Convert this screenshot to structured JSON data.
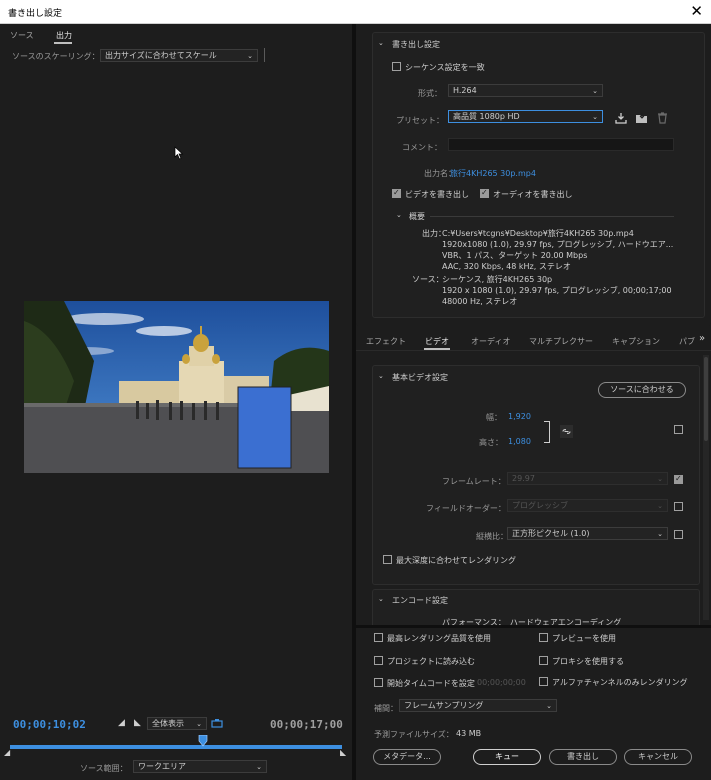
{
  "window": {
    "title": "書き出し設定",
    "close": "✕"
  },
  "left": {
    "tabs": [
      {
        "label": "ソース"
      },
      {
        "label": "出力"
      }
    ],
    "scaling_label": "ソースのスケーリング：",
    "scaling_value": "出力サイズに合わせてスケール",
    "timecode_start": "00;00;10;02",
    "timecode_end": "00;00;17;00",
    "zoom_value": "全体表示",
    "source_range_label": "ソース範囲：",
    "source_range_value": "ワークエリア",
    "playhead_fraction": 0.58
  },
  "export": {
    "section_title": "書き出し設定",
    "match_sequence": "シーケンス設定を一致",
    "format_label": "形式：",
    "format_value": "H.264",
    "preset_label": "プリセット：",
    "preset_value": "高品質 1080p HD",
    "comment_label": "コメント：",
    "comment_value": "",
    "output_name_label": "出力名：",
    "output_name_value": "旅行4KH265 30p.mp4",
    "export_video": "ビデオを書き出し",
    "export_audio": "オーディオを書き出し",
    "summary_title": "概要",
    "output_label": "出力：",
    "output_lines": [
      "C:¥Users¥tcgns¥Desktop¥旅行4KH265 30p.mp4",
      "1920x1080 (1.0), 29.97 fps, プログレッシブ, ハードウエア...",
      "VBR、1 パス、ターゲット 20.00 Mbps",
      "AAC, 320 Kbps, 48 kHz, ステレオ"
    ],
    "source_label": "ソース：",
    "source_lines": [
      "シーケンス, 旅行4KH265 30p",
      "1920 x 1080 (1.0), 29.97 fps, プログレッシブ, 00;00;17;00",
      "48000  Hz, ステレオ"
    ]
  },
  "tabs2": [
    {
      "label": "エフェクト"
    },
    {
      "label": "ビデオ"
    },
    {
      "label": "オーディオ"
    },
    {
      "label": "マルチプレクサー"
    },
    {
      "label": "キャプション"
    },
    {
      "label": "パブ"
    }
  ],
  "tabs2_more": "»",
  "video": {
    "section_title": "基本ビデオ設定",
    "match_source": "ソースに合わせる",
    "width_label": "幅：",
    "width_value": "1,920",
    "height_label": "高さ：",
    "height_value": "1,080",
    "framerate_label": "フレームレート：",
    "framerate_value": "29.97",
    "field_label": "フィールドオーダー：",
    "field_value": "プログレッシブ",
    "aspect_label": "縦横比：",
    "aspect_value": "正方形ピクセル (1.0)",
    "max_depth": "最大深度に合わせてレンダリング",
    "encode_title": "エンコード設定",
    "encode_partial": "パフォーマンス：　ハードウェアエンコーディング"
  },
  "bottom": {
    "max_quality": "最高レンダリング品質を使用",
    "preview": "プレビューを使用",
    "import": "プロジェクトに読み込む",
    "proxy": "プロキシを使用する",
    "start_tc": "開始タイムコードを設定",
    "start_tc_value": "00;00;00;00",
    "alpha": "アルファチャンネルのみレンダリング",
    "interp_label": "補間：",
    "interp_value": "フレームサンプリング",
    "filesize_label": "予測ファイルサイズ：",
    "filesize_value": "43 MB",
    "metadata": "メタデータ...",
    "queue": "キュー",
    "export": "書き出し",
    "cancel": "キャンセル"
  },
  "icons": [
    "save-preset-icon",
    "import-preset-icon",
    "delete-preset-icon",
    "link-icon",
    "cursor-icon"
  ],
  "colors": {
    "accent": "#3d8fe0",
    "placeholder": "#3b6fd1"
  }
}
